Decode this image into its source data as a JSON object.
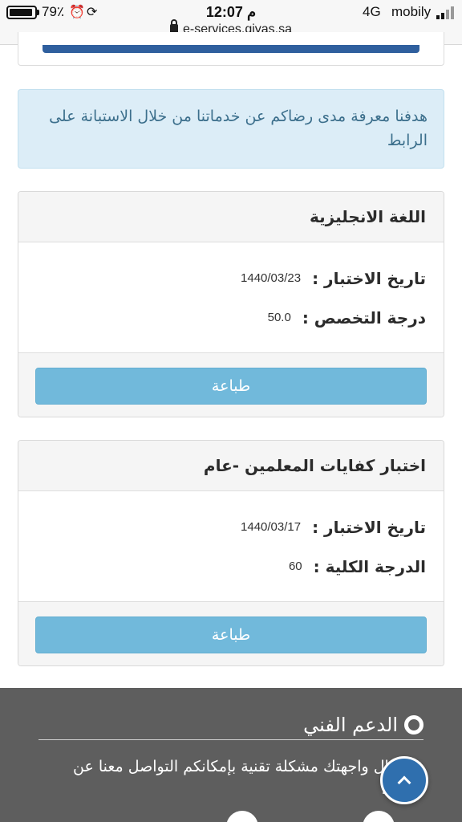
{
  "status_bar": {
    "battery": "79٪",
    "battery_level": 0.79,
    "time": "12:07 م",
    "network": "4G",
    "carrier": "mobily",
    "url": "e-services.qiyas.sa"
  },
  "alert": {
    "text": "هدفنا معرفة مدى رضاكم عن خدماتنا من خلال الاستبانة على الرابط"
  },
  "cards": [
    {
      "title": "اللغة الانجليزية",
      "rows": [
        {
          "label": "تاريخ الاختبار :",
          "value": "1440/03/23"
        },
        {
          "label": "درجة التخصص :",
          "value": "50.0"
        }
      ],
      "button": "طباعة"
    },
    {
      "title": "اختبار كفايات المعلمين -عام",
      "rows": [
        {
          "label": "تاريخ الاختبار :",
          "value": "1440/03/17"
        },
        {
          "label": "الدرجة الكلية :",
          "value": "60"
        }
      ],
      "button": "طباعة"
    }
  ],
  "footer": {
    "title": "الدعم الفني",
    "text": "في حال واجهتك مشكلة تقنية بإمكانكم التواصل معنا عن طريق:"
  },
  "colors": {
    "primary": "#2f6fae",
    "print_button": "#71b9db",
    "alert_bg": "#dcedf7",
    "footer_bg": "#5e5e5e"
  }
}
